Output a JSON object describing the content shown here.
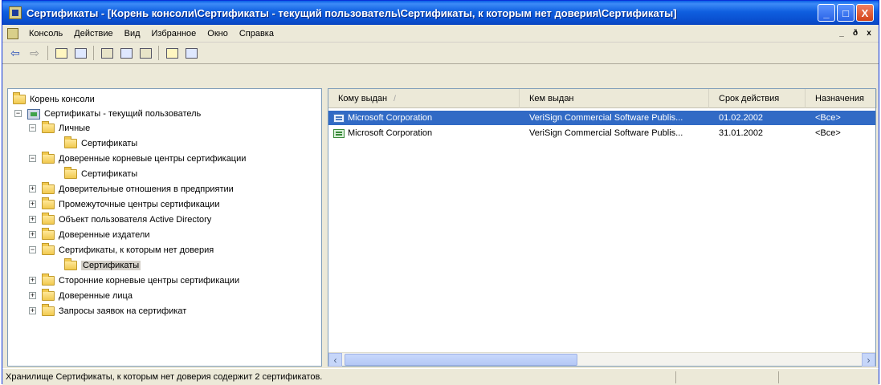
{
  "window": {
    "title": "Сертификаты - [Корень консоли\\Сертификаты - текущий пользователь\\Сертификаты, к которым нет доверия\\Сертификаты]",
    "controls": {
      "minimize": "_",
      "maximize": "□",
      "close": "X"
    }
  },
  "menu": {
    "items": [
      "Консоль",
      "Действие",
      "Вид",
      "Избранное",
      "Окно",
      "Справка"
    ],
    "mdi": {
      "minimize": "_",
      "restore": "ð",
      "close": "x"
    }
  },
  "toolbar": {
    "back": "⇦",
    "forward": "⇨"
  },
  "tree": {
    "nodes": [
      {
        "label": "Корень консоли"
      },
      {
        "label": "Сертификаты - текущий пользователь",
        "expander": "−"
      },
      {
        "label": "Личные",
        "expander": "−"
      },
      {
        "label": "Сертификаты"
      },
      {
        "label": "Доверенные корневые центры сертификации",
        "expander": "−"
      },
      {
        "label": "Сертификаты"
      },
      {
        "label": "Доверительные отношения в предприятии",
        "expander": "+"
      },
      {
        "label": "Промежуточные центры сертификации",
        "expander": "+"
      },
      {
        "label": "Объект пользователя Active Directory",
        "expander": "+"
      },
      {
        "label": "Доверенные издатели",
        "expander": "+"
      },
      {
        "label": "Сертификаты, к которым нет доверия",
        "expander": "−"
      },
      {
        "label": "Сертификаты",
        "selected": true
      },
      {
        "label": "Сторонние корневые центры сертификации",
        "expander": "+"
      },
      {
        "label": "Доверенные лица",
        "expander": "+"
      },
      {
        "label": "Запросы заявок на сертификат",
        "expander": "+"
      }
    ]
  },
  "list": {
    "columns": [
      "Кому выдан",
      "Кем выдан",
      "Срок действия",
      "Назначения"
    ],
    "sort_indicator": "/",
    "rows": [
      {
        "issued_to": "Microsoft Corporation",
        "issued_by": "VeriSign Commercial Software Publis...",
        "expires": "01.02.2002",
        "purposes": "<Все>",
        "selected": true
      },
      {
        "issued_to": "Microsoft Corporation",
        "issued_by": "VeriSign Commercial Software Publis...",
        "expires": "31.01.2002",
        "purposes": "<Все>",
        "selected": false
      }
    ],
    "scroll": {
      "left": "‹",
      "right": "›"
    }
  },
  "status": {
    "text": "Хранилище Сертификаты, к которым нет доверия содержит 2 сертификатов."
  }
}
